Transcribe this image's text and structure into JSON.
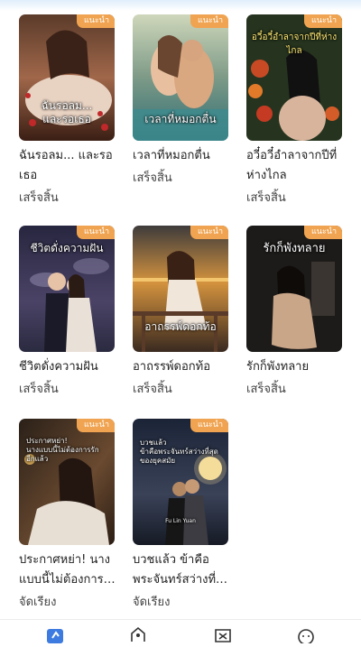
{
  "badge_label": "แนะนำ",
  "books": [
    {
      "title": "ฉันรอลม... และรอเธอ",
      "status": "เสร็จสิ้น",
      "cover_text": "ฉันรอลม...\nและรอเธอ"
    },
    {
      "title": "เวลาที่หมอกตื่น",
      "status": "เสร็จสิ้น",
      "cover_text": "เวลาที่หมอกตื่น"
    },
    {
      "title": "อวี๋อวี๋อำลาจากปีที่ห่างไกล",
      "status": "เสร็จสิ้น",
      "cover_text": "อวี๋อวี๋อำลาจากปีที่ห่างไกล"
    },
    {
      "title": "ชีวิตดั่งความฝัน",
      "status": "เสร็จสิ้น",
      "cover_text": "ชีวิตดั่งความฝัน"
    },
    {
      "title": "อาถรรพ์ดอกท้อ",
      "status": "เสร็จสิ้น",
      "cover_text": "อาถรรพ์ดอกท้อ"
    },
    {
      "title": "รักก็พังทลาย",
      "status": "เสร็จสิ้น",
      "cover_text": "รักก็พังทลาย"
    },
    {
      "title": "ประกาศหย่า! นางแบบนี้ไม่ต้องการรักอีกแล้ว",
      "status": "จัดเรียง",
      "cover_text": "ประกาศหย่า!\nนางแบบนี้ไม่ต้องการรักอีกแล้ว"
    },
    {
      "title": "บวชแล้ว ข้าคือพระจันทร์สว่างที่สุดของยุค",
      "status": "จัดเรียง",
      "cover_text": "บวชแล้ว\nข้าคือพระจันทร์สว่างที่สุดของยุคสมัย",
      "cover_subtext": "Fu Lin Yuan"
    }
  ],
  "nav": [
    {
      "icon": "bookshelf-icon"
    },
    {
      "icon": "home-icon"
    },
    {
      "icon": "discover-icon"
    },
    {
      "icon": "profile-icon"
    }
  ],
  "colors": {
    "badge": "#f0a451",
    "nav_active": "#3d7be0"
  }
}
